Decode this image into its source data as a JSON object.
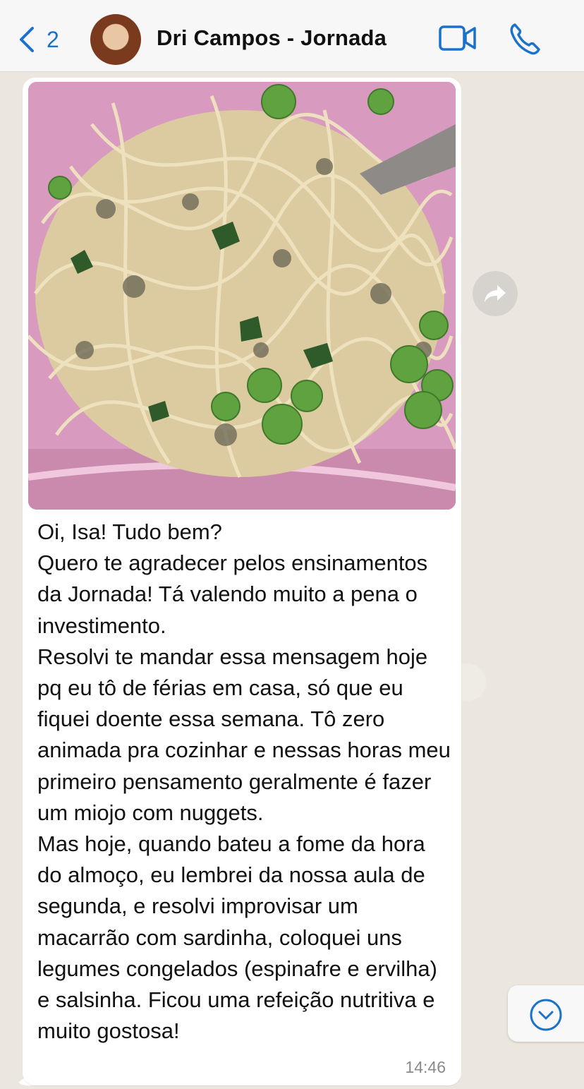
{
  "header": {
    "back_count": "2",
    "contact_name": "Dri Campos - Jornada"
  },
  "message": {
    "image_alt": "Spaghetti com sardinha, ervilha e espinafre em um pote rosa",
    "text": "Oi, Isa! Tudo bem?\nQuero te agradecer pelos ensinamentos da Jornada! Tá valendo muito a pena o investimento.\nResolvi te mandar essa mensagem hoje pq eu tô de férias em casa, só que eu fiquei doente essa semana. Tô zero animada pra cozinhar e nessas horas meu primeiro pensamento geralmente é fazer um miojo com nuggets.\nMas hoje, quando bateu a fome da hora do almoço, eu lembrei da nossa aula de segunda, e resolvi improvisar um macarrão com sardinha, coloquei uns legumes congelados (espinafre e ervilha) e salsinha. Ficou uma refeição nutritiva e muito gostosa!",
    "time": "14:46"
  },
  "colors": {
    "accent": "#1a73c9",
    "bubble": "#ffffff",
    "wallpaper": "#ebe7df"
  },
  "icons": {
    "back": "chevron-left-icon",
    "video": "video-camera-icon",
    "call": "phone-icon",
    "forward": "forward-arrow-icon",
    "scroll": "chevron-down-circle-icon"
  }
}
